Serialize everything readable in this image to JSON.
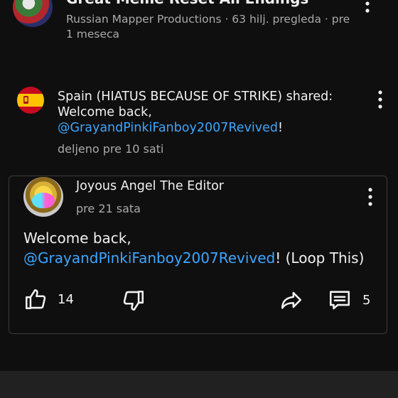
{
  "video": {
    "title": "Great Meme Reset All Endings",
    "meta": "Russian Mapper Productions · 63 hilj. pregleda · pre 1 meseca"
  },
  "share": {
    "author_prefix": "Spain (HIATUS BECAUSE OF STRIKE) shared: Welcome back, ",
    "mention": "@GrayandPinkiFanboy2007Revived",
    "suffix": "!",
    "time": "deljeno pre 10 sati"
  },
  "post": {
    "author": "Joyous Angel The Editor",
    "time": "pre 21 sata",
    "text_prefix": "Welcome back,",
    "mention": "@GrayandPinkiFanboy2007Revived",
    "text_suffix": "! (Loop This)",
    "likes": "14",
    "comments": "5"
  },
  "icons": {
    "more": "more-vert-icon",
    "like": "thumb-up-icon",
    "dislike": "thumb-down-icon",
    "share": "share-arrow-icon",
    "comment": "comment-icon"
  },
  "colors": {
    "background": "#0f0f0f",
    "link": "#3ea6ff",
    "secondary_text": "#aaaaaa",
    "card_border": "#3a3a3a"
  }
}
